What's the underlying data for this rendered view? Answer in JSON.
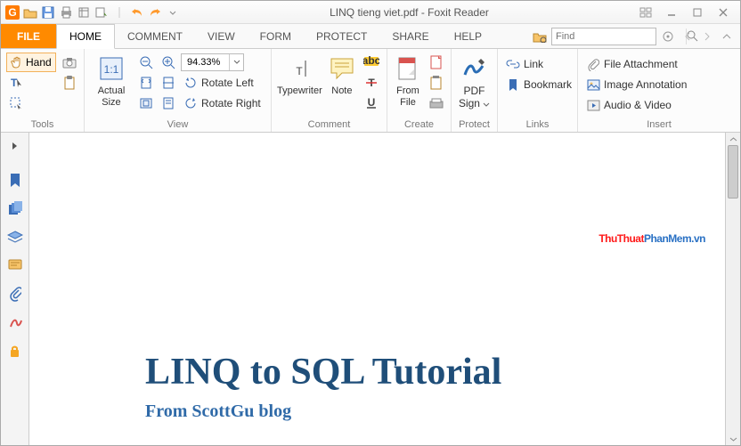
{
  "title": "LINQ tieng viet.pdf - Foxit Reader",
  "tabs": {
    "file": "FILE",
    "home": "HOME",
    "comment": "COMMENT",
    "view": "VIEW",
    "form": "FORM",
    "protect": "PROTECT",
    "share": "SHARE",
    "help": "HELP"
  },
  "find": {
    "placeholder": "Find"
  },
  "ribbon": {
    "tools": {
      "hand": "Hand",
      "label": "Tools"
    },
    "view": {
      "actual": "Actual\nSize",
      "rotateLeft": "Rotate Left",
      "rotateRight": "Rotate Right",
      "zoom": "94.33%",
      "label": "View"
    },
    "comment": {
      "typewriter": "Typewriter",
      "note": "Note",
      "label": "Comment"
    },
    "create": {
      "fromfile": "From\nFile",
      "label": "Create"
    },
    "protect": {
      "pdfsign": "PDF\nSign",
      "label": "Protect"
    },
    "links": {
      "link": "Link",
      "bookmark": "Bookmark",
      "label": "Links"
    },
    "insert": {
      "fileattach": "File Attachment",
      "imageannot": "Image Annotation",
      "audiovideo": "Audio & Video",
      "label": "Insert"
    }
  },
  "document": {
    "watermark1": "ThuThuat",
    "watermark2": "PhanMem",
    "watermark3": ".vn",
    "title": "LINQ to SQL Tutorial",
    "subtitle": "From ScottGu blog"
  }
}
